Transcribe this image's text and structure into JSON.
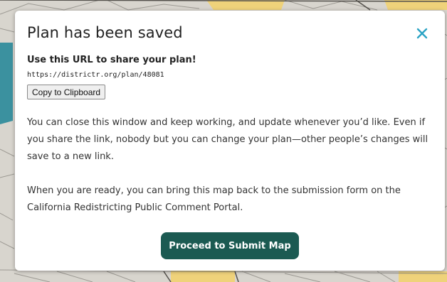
{
  "modal": {
    "title": "Plan has been saved",
    "share_heading": "Use this URL to share your plan!",
    "share_url": "https://districtr.org/plan/48081",
    "copy_label": "Copy to Clipboard",
    "paragraph1": "You can close this window and keep working, and update whenever you’d like. Even if you share the link, nobody but you can change your plan—other people’s changes will save to a new link.",
    "paragraph2": "When you are ready, you can bring this map back to the submission form on the California Redistricting Public Comment Portal.",
    "submit_label": "Proceed to Submit Map"
  },
  "colors": {
    "accent_close": "#2ba3c4",
    "submit_bg": "#1b5a52",
    "map_yellow": "#efd27a",
    "map_teal": "#2a8a9a"
  },
  "icons": {
    "close": "close-icon"
  }
}
